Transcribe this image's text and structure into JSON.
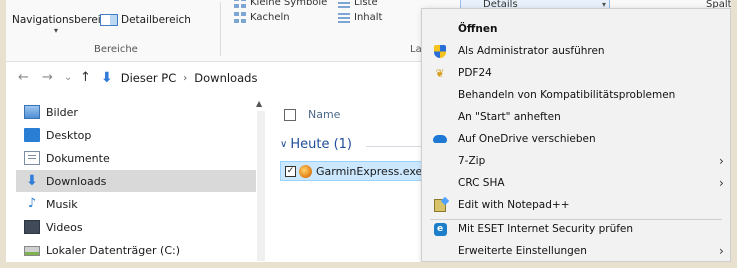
{
  "ribbon": {
    "nav_pane": "Navigationsbereich",
    "details_pane": "Detailbereich",
    "group_panes": "Bereiche",
    "group_layout": "La",
    "small_icons": "Kleine Symbole",
    "tiles": "Kacheln",
    "list": "Liste",
    "content": "Inhalt",
    "details": "Details",
    "columns": "Spalt"
  },
  "address": {
    "back": "←",
    "forward": "→",
    "recent": "⌄",
    "up": "↑",
    "crumbs": [
      "Dieser PC",
      "Downloads"
    ],
    "crumb_sep": "›"
  },
  "sidebar": {
    "items": [
      {
        "label": "Bilder"
      },
      {
        "label": "Desktop"
      },
      {
        "label": "Dokumente"
      },
      {
        "label": "Downloads"
      },
      {
        "label": "Musik"
      },
      {
        "label": "Videos"
      },
      {
        "label": "Lokaler Datenträger (C:)"
      }
    ],
    "scroll_up": "▲"
  },
  "filelist": {
    "column_name": "Name",
    "group_label": "Heute (1)",
    "group_chevron": "∨",
    "file_name": "GarminExpress.exe",
    "file_check": "✓"
  },
  "context_menu": {
    "items": [
      {
        "label": "Öffnen",
        "icon": "none"
      },
      {
        "label": "Als Administrator ausführen",
        "icon": "uac-shield-icon"
      },
      {
        "label": "PDF24",
        "icon": "pdf24-icon"
      },
      {
        "label": "Behandeln von Kompatibilitätsproblemen",
        "icon": "none"
      },
      {
        "label": "An \"Start\" anheften",
        "icon": "none"
      },
      {
        "label": "Auf OneDrive verschieben",
        "icon": "onedrive-icon"
      },
      {
        "label": "7-Zip",
        "icon": "none"
      },
      {
        "label": "CRC SHA",
        "icon": "none"
      },
      {
        "label": "Edit with Notepad++",
        "icon": "notepadpp-icon"
      },
      {
        "label": "Mit ESET Internet Security prüfen",
        "icon": "eset-icon"
      },
      {
        "label": "Erweiterte Einstellungen",
        "icon": "none"
      }
    ],
    "submenu_arrow": "›",
    "pdf24_glyph": "❦",
    "eset_glyph": "e"
  }
}
